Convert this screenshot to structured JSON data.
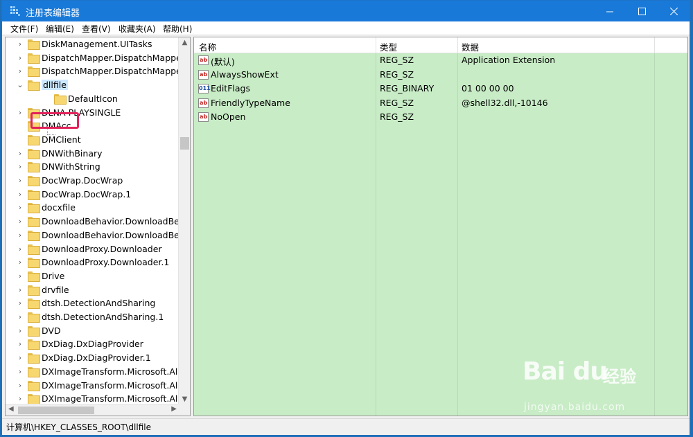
{
  "window": {
    "title": "注册表编辑器"
  },
  "menu": [
    "文件(F)",
    "编辑(E)",
    "查看(V)",
    "收藏夹(A)",
    "帮助(H)"
  ],
  "tree": [
    {
      "label": "DiskManagement.UITasks",
      "arrow": "›",
      "level": 0
    },
    {
      "label": "DispatchMapper.DispatchMapper",
      "arrow": "›",
      "level": 0
    },
    {
      "label": "DispatchMapper.DispatchMapper.",
      "arrow": "›",
      "level": 0
    },
    {
      "label": "dllfile",
      "arrow": "⌄",
      "level": 0,
      "selected": true
    },
    {
      "label": "DefaultIcon",
      "arrow": "",
      "level": 1
    },
    {
      "label": "DLNA-PLAYSINGLE",
      "arrow": "›",
      "level": 0
    },
    {
      "label": "DMAcc",
      "arrow": "",
      "level": 0
    },
    {
      "label": "DMClient",
      "arrow": "",
      "level": 0
    },
    {
      "label": "DNWithBinary",
      "arrow": "›",
      "level": 0
    },
    {
      "label": "DNWithString",
      "arrow": "›",
      "level": 0
    },
    {
      "label": "DocWrap.DocWrap",
      "arrow": "›",
      "level": 0
    },
    {
      "label": "DocWrap.DocWrap.1",
      "arrow": "›",
      "level": 0
    },
    {
      "label": "docxfile",
      "arrow": "›",
      "level": 0
    },
    {
      "label": "DownloadBehavior.DownloadBeha",
      "arrow": "›",
      "level": 0
    },
    {
      "label": "DownloadBehavior.DownloadBeha",
      "arrow": "›",
      "level": 0
    },
    {
      "label": "DownloadProxy.Downloader",
      "arrow": "›",
      "level": 0
    },
    {
      "label": "DownloadProxy.Downloader.1",
      "arrow": "›",
      "level": 0
    },
    {
      "label": "Drive",
      "arrow": "›",
      "level": 0
    },
    {
      "label": "drvfile",
      "arrow": "›",
      "level": 0
    },
    {
      "label": "dtsh.DetectionAndSharing",
      "arrow": "›",
      "level": 0
    },
    {
      "label": "dtsh.DetectionAndSharing.1",
      "arrow": "›",
      "level": 0
    },
    {
      "label": "DVD",
      "arrow": "›",
      "level": 0
    },
    {
      "label": "DxDiag.DxDiagProvider",
      "arrow": "›",
      "level": 0
    },
    {
      "label": "DxDiag.DxDiagProvider.1",
      "arrow": "›",
      "level": 0
    },
    {
      "label": "DXImageTransform.Microsoft.Alph",
      "arrow": "›",
      "level": 0
    },
    {
      "label": "DXImageTransform.Microsoft.Alph",
      "arrow": "›",
      "level": 0
    },
    {
      "label": "DXImageTransform.Microsoft.Alph",
      "arrow": "›",
      "level": 0
    }
  ],
  "columns": {
    "name": "名称",
    "type": "类型",
    "data": "数据"
  },
  "values": [
    {
      "icon": "ab",
      "name": "(默认)",
      "type": "REG_SZ",
      "data": "Application Extension"
    },
    {
      "icon": "ab",
      "name": "AlwaysShowExt",
      "type": "REG_SZ",
      "data": ""
    },
    {
      "icon": "bin",
      "name": "EditFlags",
      "type": "REG_BINARY",
      "data": "01 00 00 00"
    },
    {
      "icon": "ab",
      "name": "FriendlyTypeName",
      "type": "REG_SZ",
      "data": "@shell32.dll,-10146"
    },
    {
      "icon": "ab",
      "name": "NoOpen",
      "type": "REG_SZ",
      "data": ""
    }
  ],
  "status": {
    "path": "计算机\\HKEY_CLASSES_ROOT\\dllfile"
  },
  "watermark": {
    "logo": "Bai du",
    "cn": "经验",
    "url": "jingyan.baidu.com"
  }
}
